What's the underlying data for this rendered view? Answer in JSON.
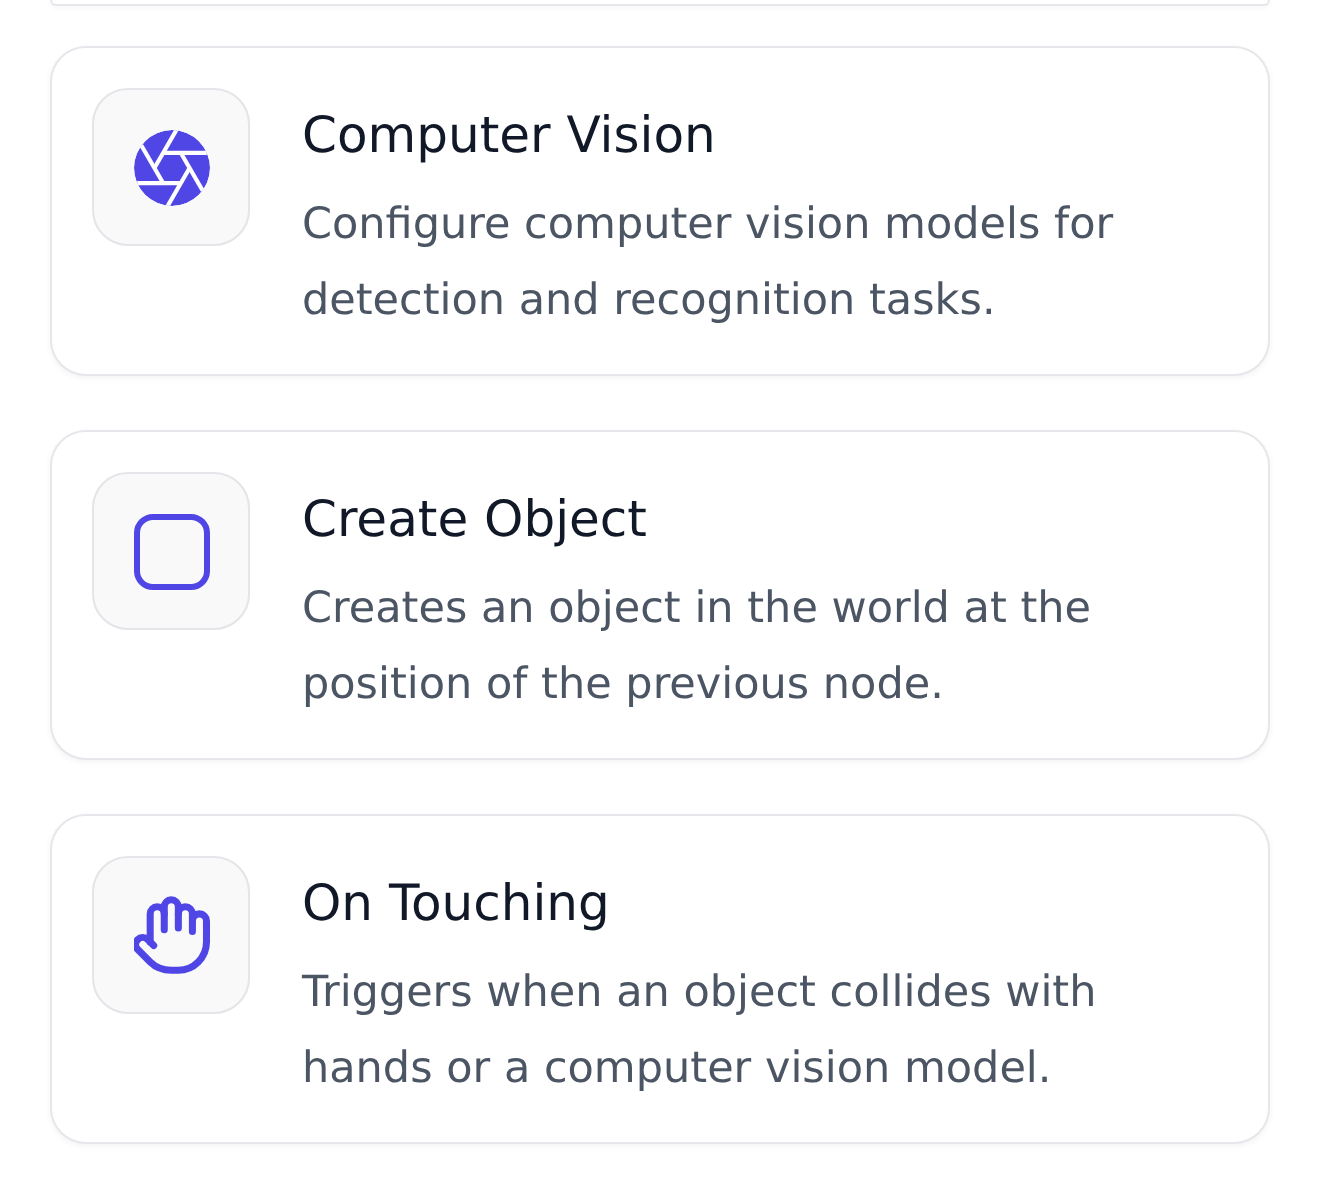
{
  "nodes": [
    {
      "kind": "vision",
      "title": "Computer Vision",
      "description": "Configure computer vision models for detection and recognition tasks."
    },
    {
      "kind": "object",
      "title": "Create Object",
      "description": "Creates an object in the world at the position of the previous node."
    },
    {
      "kind": "touch",
      "title": "On Touching",
      "description": "Triggers when an object collides with hands or a computer vision model."
    }
  ]
}
